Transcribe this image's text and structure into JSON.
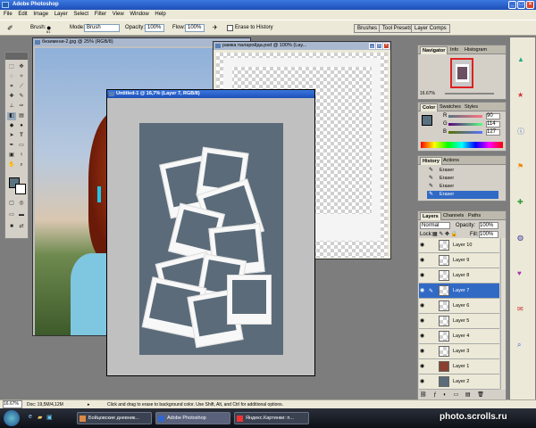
{
  "app": {
    "title": "Adobe Photoshop"
  },
  "menu": [
    "File",
    "Edit",
    "Image",
    "Layer",
    "Select",
    "Filter",
    "View",
    "Window",
    "Help"
  ],
  "options": {
    "brush_label": "Brush:",
    "brush_size": "61",
    "mode_label": "Mode:",
    "mode_value": "Brush",
    "opacity_label": "Opacity:",
    "opacity_value": "100%",
    "flow_label": "Flow:",
    "flow_value": "100%",
    "erase_history": "Erase to History",
    "wells": [
      "Brushes",
      "Tool Presets",
      "Layer Comps"
    ]
  },
  "documents": {
    "doc1": {
      "title": "безимени-2.jpg @ 25% (RGB/8)"
    },
    "doc2": {
      "title": "рамка паларойда.psd @ 100% (Lay..."
    },
    "doc3": {
      "title": "Untitled-1 @ 16,7% (Layer 7, RGB/8)"
    }
  },
  "panels": {
    "navigator": {
      "tabs": [
        "Navigator",
        "Info",
        "Histogram"
      ],
      "zoom": "16.67%"
    },
    "color": {
      "tabs": [
        "Color",
        "Swatches",
        "Styles"
      ],
      "channels": [
        {
          "label": "R",
          "value": "90"
        },
        {
          "label": "G",
          "value": "114"
        },
        {
          "label": "B",
          "value": "127"
        }
      ]
    },
    "history": {
      "tabs": [
        "History",
        "Actions"
      ],
      "items": [
        "Eraser",
        "Eraser",
        "Eraser",
        "Eraser"
      ],
      "selected_index": 3
    },
    "layers": {
      "tabs": [
        "Layers",
        "Channels",
        "Paths"
      ],
      "blend_mode": "Normal",
      "opacity_label": "Opacity:",
      "opacity_value": "100%",
      "lock_label": "Lock:",
      "fill_label": "Fill:",
      "fill_value": "100%",
      "items": [
        "Layer 10",
        "Layer 9",
        "Layer 8",
        "Layer 7",
        "Layer 6",
        "Layer 5",
        "Layer 4",
        "Layer 3",
        "Layer 1",
        "Layer 2"
      ],
      "selected": "Layer 7"
    }
  },
  "status": {
    "zoom": "16.67%",
    "doc": "Doc: 19,5M/4,12M",
    "hint": "Click and drag to erase to background color.  Use Shift, Alt, and Ctrl for additional options."
  },
  "taskbar": {
    "tasks": [
      "Бойцовские дневник...",
      "Adobe Photoshop",
      "Яндекс.Картинки: п..."
    ],
    "watermark": "photo.scrolls.ru"
  },
  "colors": {
    "foreground": "#5a7280",
    "canvas_bg": "#5b6b7a",
    "selection": "#316ac5"
  }
}
